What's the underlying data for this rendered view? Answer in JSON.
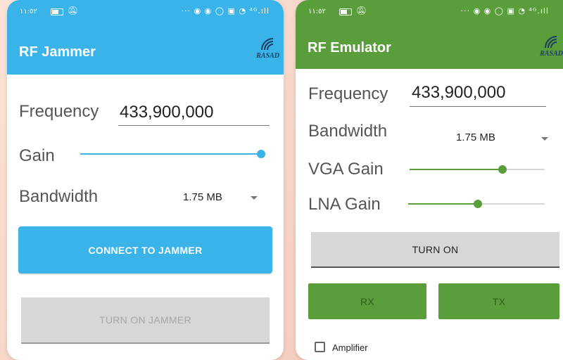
{
  "status_bar": {
    "time": "١١:٥٢",
    "icons": "··· ◉ ◉ ◯ ▣ ◔ ⁴ᴳ.ıll"
  },
  "left_app": {
    "title": "RF Jammer",
    "logo_text": "RASAD",
    "frequency_label": "Frequency",
    "frequency_value": "433,900,000",
    "gain_label": "Gain",
    "gain_level_percent": 100,
    "bandwidth_label": "Bandwidth",
    "bandwidth_value": "1.75 MB",
    "connect_button": "CONNECT TO JAMMER",
    "turn_on_button": "TURN ON JAMMER",
    "accent_color": "#3ab4e8"
  },
  "right_app": {
    "title": "RF Emulator",
    "logo_text": "RASAD",
    "frequency_label": "Frequency",
    "frequency_value": "433,900,000",
    "bandwidth_label": "Bandwidth",
    "bandwidth_value": "1.75 MB",
    "vga_gain_label": "VGA Gain",
    "vga_gain_level_percent": 69,
    "lna_gain_label": "LNA Gain",
    "lna_gain_level_percent": 51,
    "turn_on_button": "TURN ON",
    "rx_button": "RX",
    "tx_button": "TX",
    "amplifier_label": "Amplifier",
    "amplifier_checked": false,
    "accent_color": "#5a9e3c"
  }
}
